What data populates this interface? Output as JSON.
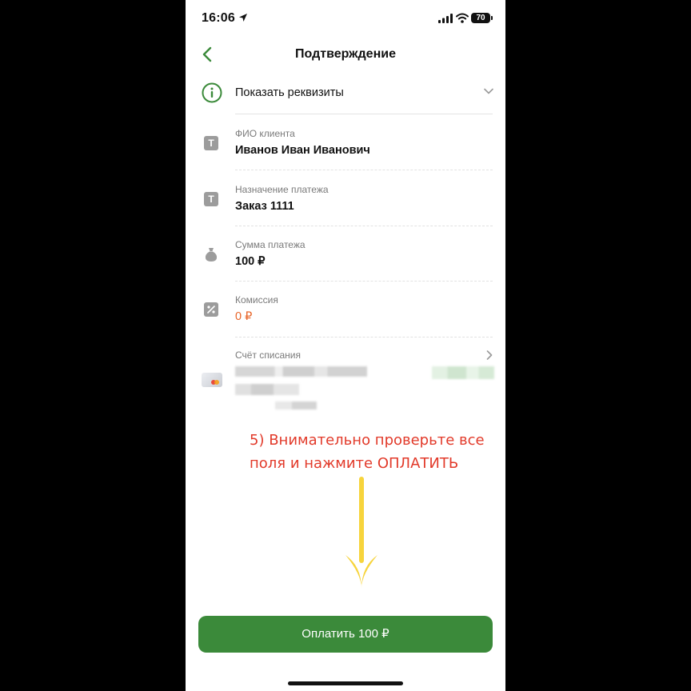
{
  "status_bar": {
    "time": "16:06",
    "battery": "70"
  },
  "header": {
    "title": "Подтверждение"
  },
  "requisites": {
    "label": "Показать реквизиты"
  },
  "fields": [
    {
      "label": "ФИО клиента",
      "value": "Иванов Иван Иванович"
    },
    {
      "label": "Назначение платежа",
      "value": "Заказ 1111"
    },
    {
      "label": "Сумма платежа",
      "value": "100 ₽"
    },
    {
      "label": "Комиссия",
      "value": "0 ₽"
    }
  ],
  "account": {
    "label": "Счёт списания"
  },
  "annotation": {
    "line1": "5) Внимательно проверьте все",
    "line2": "поля и нажмите ОПЛАТИТЬ"
  },
  "pay_button": {
    "label": "Оплатить 100 ₽"
  },
  "colors": {
    "accent": "#3b8a3a",
    "annotation": "#e23a2a",
    "arrow": "#f7d43c",
    "commission": "#e8662a"
  },
  "icons": [
    "location-arrow-icon",
    "signal-icon",
    "wifi-icon",
    "battery-icon",
    "back-chevron-icon",
    "info-icon",
    "chevron-down-icon",
    "text-icon",
    "money-bag-icon",
    "percent-icon",
    "card-icon",
    "chevron-right-icon",
    "arrow-down-icon"
  ]
}
